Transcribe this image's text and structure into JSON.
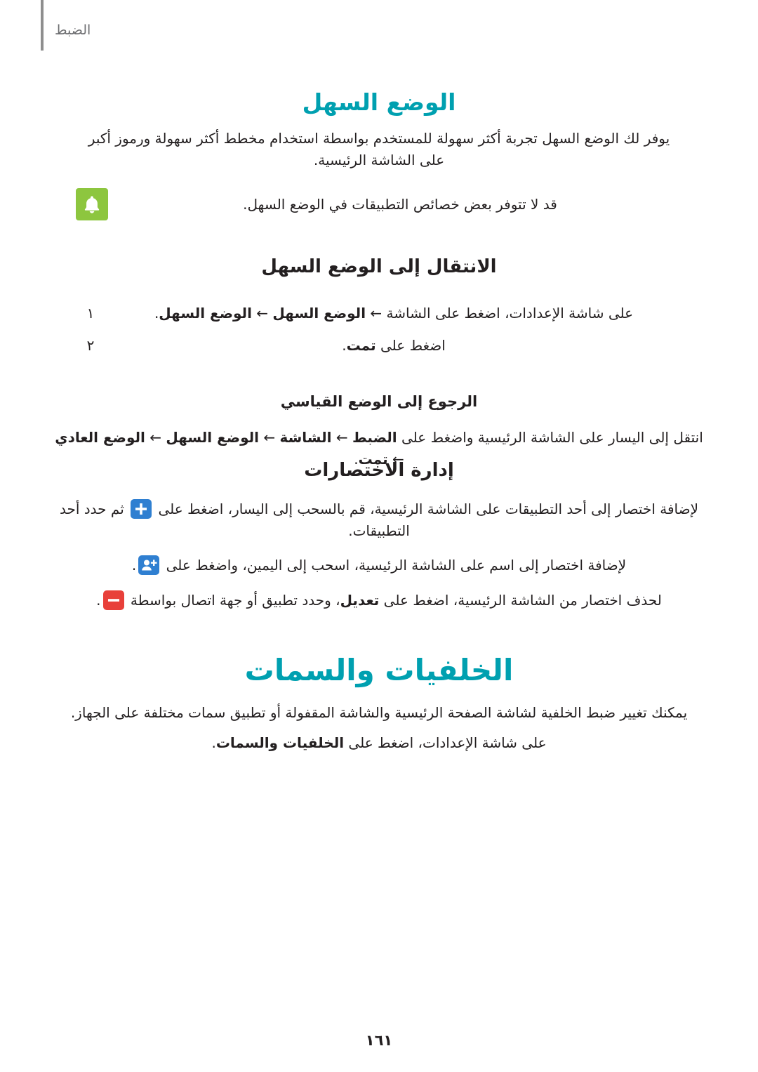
{
  "header": {
    "chapter_label": "الضبط"
  },
  "sections": {
    "easy_mode": {
      "title": "الوضع السهل",
      "intro": "يوفر لك الوضع السهل تجربة أكثر سهولة للمستخدم بواسطة استخدام مخطط أكثر سهولة ورموز أكبر على الشاشة الرئيسية.",
      "note": "قد لا تتوفر بعض خصائص التطبيقات في الوضع السهل.",
      "note_icon": "bell-icon",
      "switch_heading": "الانتقال إلى الوضع السهل",
      "steps": [
        {
          "number": "١",
          "text_parts": [
            "على شاشة الإعدادات، اضغط على الشاشة ",
            "←",
            " ",
            "الوضع السهل",
            " ",
            "←",
            " ",
            "الوضع السهل",
            "."
          ]
        },
        {
          "number": "٢",
          "text_parts": [
            "اضغط على ",
            "تمت",
            "."
          ]
        }
      ],
      "return_heading": "الرجوع إلى الوضع القياسي",
      "return_text_parts": [
        "انتقل إلى اليسار  على الشاشة الرئيسية واضغط على ",
        "الضبط",
        " ",
        "←",
        " ",
        "الشاشة",
        " ",
        "←",
        " ",
        "الوضع السهل",
        " ",
        "←",
        " ",
        "الوضع العادي",
        " ",
        "←",
        " ",
        "تمت",
        "."
      ],
      "shortcuts_heading": "إدارة الاختصارات",
      "shortcut_add_app": {
        "before": "لإضافة اختصار إلى أحد التطبيقات على الشاشة الرئيسية، قم بالسحب إلى اليسار، اضغط على ",
        "icon": "plus-icon",
        "after": " ثم حدد أحد التطبيقات."
      },
      "shortcut_add_contact": {
        "before": "لإضافة اختصار إلى اسم على الشاشة الرئيسية، اسحب إلى اليمين، واضغط على ",
        "icon": "add-person-icon",
        "after": "."
      },
      "shortcut_delete": {
        "before": "لحذف اختصار من الشاشة الرئيسية، اضغط على ",
        "bold": "تعديل",
        "middle": "، وحدد تطبيق أو جهة اتصال بواسطة ",
        "icon": "minus-icon",
        "after": "."
      }
    },
    "wallpapers": {
      "title": "الخلفيات والسمات",
      "intro": "يمكنك تغيير  ضبط الخلفية لشاشة الصفحة الرئيسية والشاشة المقفولة أو تطبيق سمات مختلفة على الجهاز.",
      "steps_text_parts": [
        "على شاشة الإعدادات، اضغط على ",
        "الخلفيات والسمات",
        "."
      ]
    }
  },
  "page_number": "١٦١"
}
